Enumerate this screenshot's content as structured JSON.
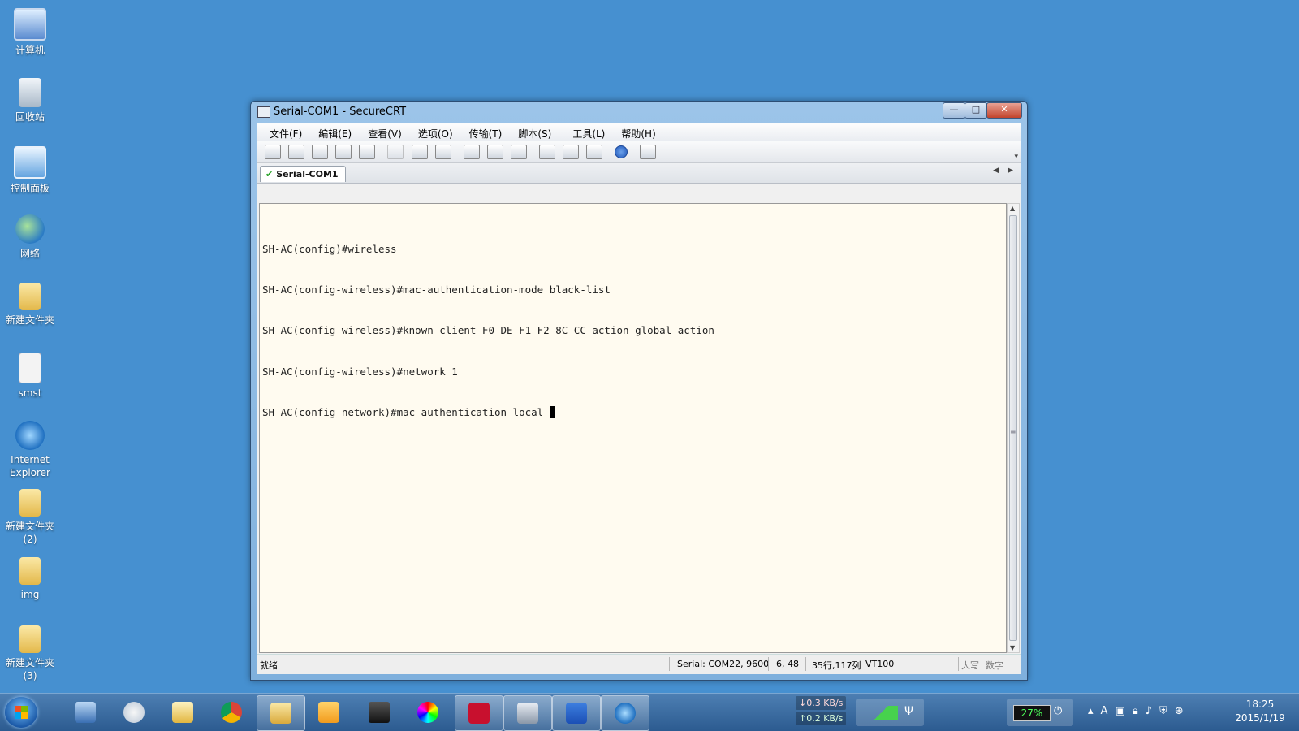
{
  "desktop": {
    "icons": [
      {
        "label": "计算机",
        "icon": "computer-icon"
      },
      {
        "label": "回收站",
        "icon": "recycle-bin-icon"
      },
      {
        "label": "控制面板",
        "icon": "control-panel-icon"
      },
      {
        "label": "网络",
        "icon": "network-icon"
      },
      {
        "label": "新建文件夹",
        "icon": "folder-icon"
      },
      {
        "label": "smst",
        "icon": "shortcut-file-icon"
      },
      {
        "label": "Internet Explorer",
        "icon": "internet-explorer-icon"
      },
      {
        "label": "新建文件夹 (2)",
        "icon": "folder-icon"
      },
      {
        "label": "img",
        "icon": "folder-icon"
      },
      {
        "label": "新建文件夹 (3)",
        "icon": "folder-icon"
      }
    ]
  },
  "window": {
    "title": "Serial-COM1 - SecureCRT",
    "controls": {
      "minimize": "—",
      "maximize": "□",
      "close": "✕"
    },
    "menu": [
      "文件(F)",
      "编辑(E)",
      "查看(V)",
      "选项(O)",
      "传输(T)",
      "脚本(S)",
      "工具(L)",
      "帮助(H)"
    ],
    "tab": {
      "label": "Serial-COM1",
      "status_icon": "check-icon"
    },
    "terminal": {
      "lines": [
        "SH-AC(config)#wireless",
        "SH-AC(config-wireless)#mac-authentication-mode black-list",
        "SH-AC(config-wireless)#known-client F0-DE-F1-F2-8C-CC action global-action",
        "SH-AC(config-wireless)#network 1",
        "SH-AC(config-network)#mac authentication local "
      ],
      "background": "#fffbf0"
    },
    "status": {
      "ready": "就绪",
      "serial": "Serial: COM22, 9600",
      "cursor_pos": "6, 48",
      "size": "35行,117列",
      "emulation": "VT100",
      "caps": "大写",
      "num": "数字"
    }
  },
  "taskbar": {
    "net_down": "0.3 KB/s",
    "net_up": "0.2 KB/s",
    "battery": "27%",
    "time": "18:25",
    "date": "2015/1/19",
    "apps": [
      "remote-desktop-icon",
      "paint-icon",
      "file-explorer-icon",
      "chrome-icon",
      "folder-icon",
      "outlook-icon",
      "tool-icon",
      "color-picker-icon",
      "huawei-icon",
      "securecrt-icon",
      "word-icon",
      "internet-explorer-icon"
    ]
  },
  "colors": {
    "desktop": "#4690d0",
    "accent": "#2c5b90"
  }
}
